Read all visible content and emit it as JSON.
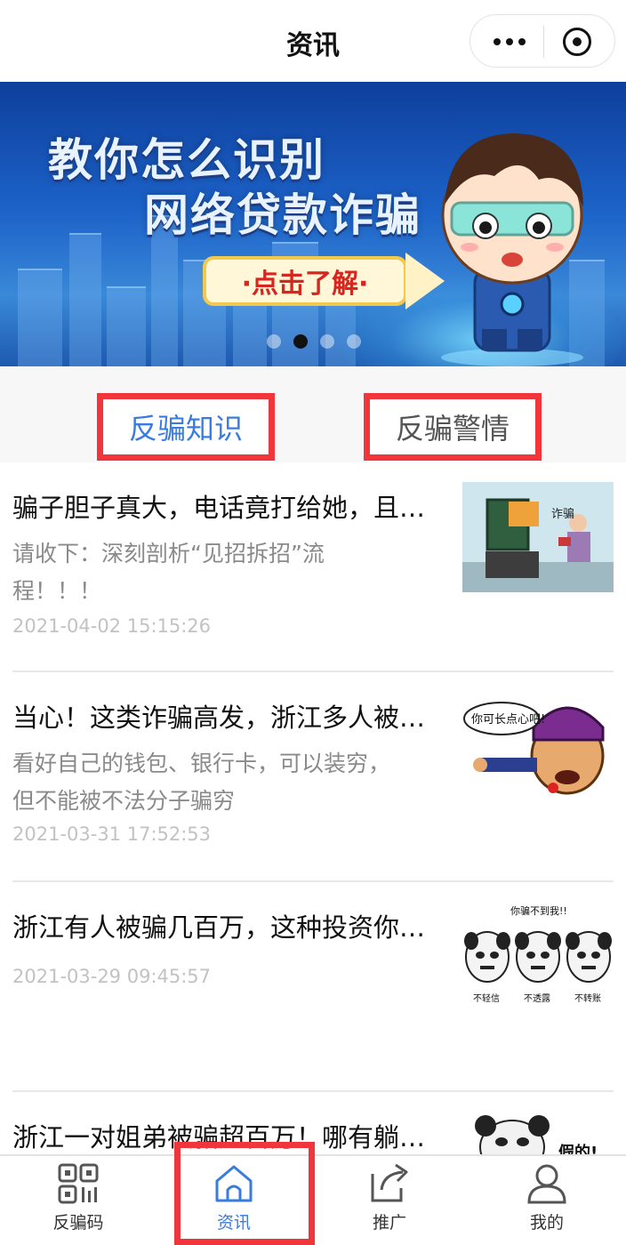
{
  "header": {
    "title": "资讯",
    "menu_icon": "more-dots-icon",
    "close_icon": "miniprogram-close-icon"
  },
  "banner": {
    "title_line1": "教你怎么识别",
    "title_line2": "网络贷款诈骗",
    "cta": "·点击了解·",
    "slide_count": 4,
    "active_slide": 2
  },
  "tabs": [
    {
      "label": "反骗知识",
      "active": true
    },
    {
      "label": "反骗警情",
      "active": false
    }
  ],
  "news": [
    {
      "title": "骗子胆子真大，电话竟打给她，且…",
      "summary": "请收下：深刻剖析“见招拆招”流程！！！",
      "date": "2021-04-02 15:15:26",
      "thumb_text": "诈骗"
    },
    {
      "title": "当心！这类诈骗高发，浙江多人被…",
      "summary": "看好自己的钱包、银行卡，可以装穷，但不能被不法分子骗穷",
      "date": "2021-03-31 17:52:53",
      "thumb_text": "你可长点心吧!"
    },
    {
      "title": "浙江有人被骗几百万，这种投资你…",
      "summary": "",
      "date": "2021-03-29 09:45:57",
      "thumb_text": "你骗不到我!!",
      "thumb_captions": [
        "不轻信",
        "不透露",
        "不转账"
      ]
    },
    {
      "title": "浙江一对姐弟被骗超百万！哪有躺…",
      "summary": "",
      "date": "",
      "thumb_text": "假的!"
    }
  ],
  "tabbar": [
    {
      "label": "反骗码",
      "icon": "qr-code-icon",
      "active": false
    },
    {
      "label": "资讯",
      "icon": "home-icon",
      "active": true
    },
    {
      "label": "推广",
      "icon": "share-icon",
      "active": false
    },
    {
      "label": "我的",
      "icon": "user-icon",
      "active": false
    }
  ],
  "colors": {
    "accent": "#3a7be0",
    "highlight_box": "#f0353d",
    "banner_blue": "#1c62c8",
    "date_gray": "#c2c2c2"
  }
}
